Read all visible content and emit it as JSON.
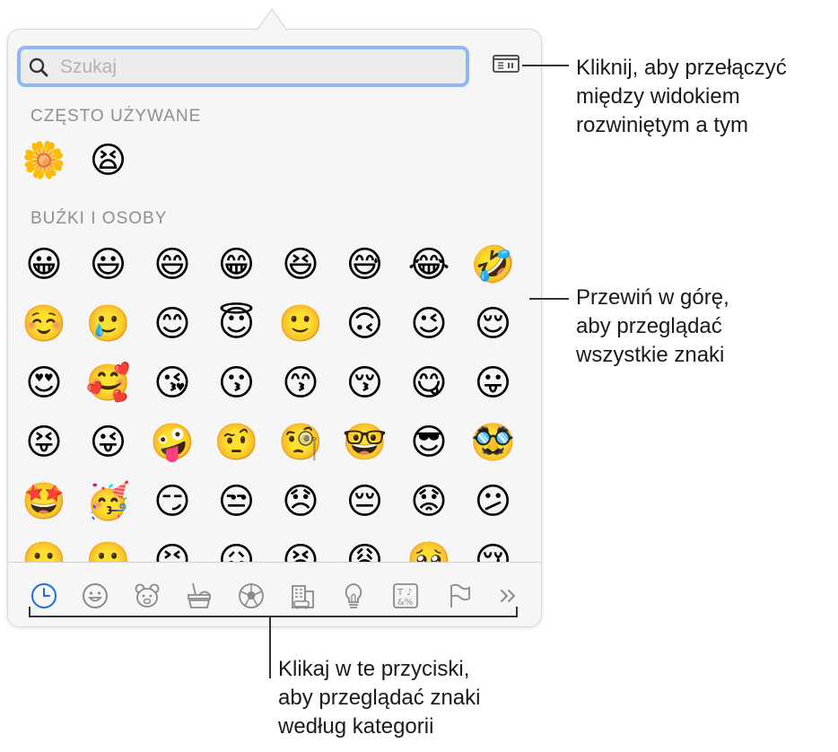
{
  "search": {
    "placeholder": "Szukaj"
  },
  "sections": {
    "frequent": {
      "title": "CZĘSTO UŻYWANE",
      "emojis": [
        "🌼",
        "😫"
      ]
    },
    "smileys": {
      "title": "BUŹKI I OSOBY",
      "emojis": [
        "😀",
        "😃",
        "😄",
        "😁",
        "😆",
        "😅",
        "😂",
        "🤣",
        "☺️",
        "🥲",
        "😊",
        "😇",
        "🙂",
        "🙃",
        "😉",
        "😌",
        "😍",
        "🥰",
        "😘",
        "😗",
        "😙",
        "😚",
        "😋",
        "😛",
        "😝",
        "😜",
        "🤪",
        "🤨",
        "🧐",
        "🤓",
        "😎",
        "🥸",
        "🤩",
        "🥳",
        "😏",
        "😒",
        "😞",
        "😔",
        "😟",
        "😕",
        "🙁",
        "☹️",
        "😣",
        "😖",
        "😫",
        "😩",
        "🥺",
        "😢"
      ]
    }
  },
  "categories": [
    {
      "icon": "clock-icon",
      "active": true
    },
    {
      "icon": "smiley-icon"
    },
    {
      "icon": "animal-icon"
    },
    {
      "icon": "food-icon"
    },
    {
      "icon": "ball-icon"
    },
    {
      "icon": "building-icon"
    },
    {
      "icon": "lightbulb-icon"
    },
    {
      "icon": "symbols-icon"
    },
    {
      "icon": "flag-icon"
    },
    {
      "icon": "more-icon"
    }
  ],
  "callouts": {
    "toggle": [
      "Kliknij, aby przełączyć",
      "między widokiem",
      "rozwiniętym a tym"
    ],
    "scroll": [
      "Przewiń w górę,",
      "aby przeglądać",
      "wszystkie znaki"
    ],
    "categories": [
      "Klikaj w te przyciski,",
      "aby przeglądać znaki",
      "według kategorii"
    ]
  },
  "colors": {
    "accent": "#1a6fe0",
    "focus_ring": "#8fb8ee",
    "icon": "#8a8a8a"
  }
}
